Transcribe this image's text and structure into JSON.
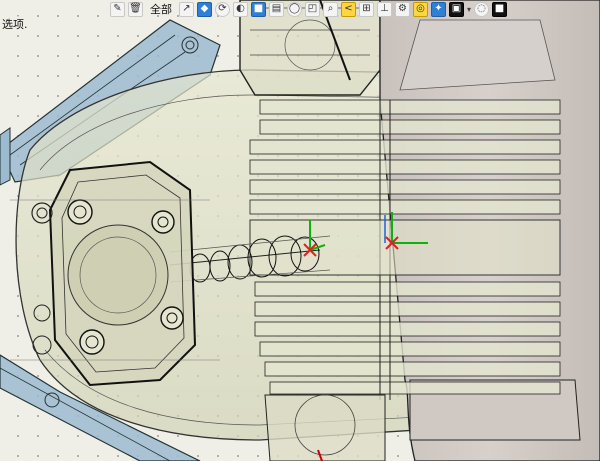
{
  "hint_text": "选项.",
  "toolbar": {
    "filter_label": "全部",
    "icons": [
      "edit-brush-icon",
      "trash-icon",
      "filter-dropdown",
      "arrow-icon",
      "select-icon",
      "rotate-icon",
      "section-icon",
      "box-icon",
      "shade-icon",
      "lasso-icon",
      "view-cube-icon",
      "magnify-icon",
      "snap-icon",
      "grid-icon",
      "pin-icon",
      "settings-icon",
      "target-icon",
      "highlight-icon",
      "display-icon",
      "color-swatch-icon",
      "camera-icon"
    ]
  },
  "colors": {
    "background": "#efefe7",
    "part_fill": "#dedfc6",
    "housing_fill": "#cfc8c4",
    "bracket_blue": "#8fb5cf",
    "axis_x": "#e02020",
    "axis_y": "#10b010",
    "axis_z": "#2060e0",
    "active_tool": "#ffd640"
  }
}
